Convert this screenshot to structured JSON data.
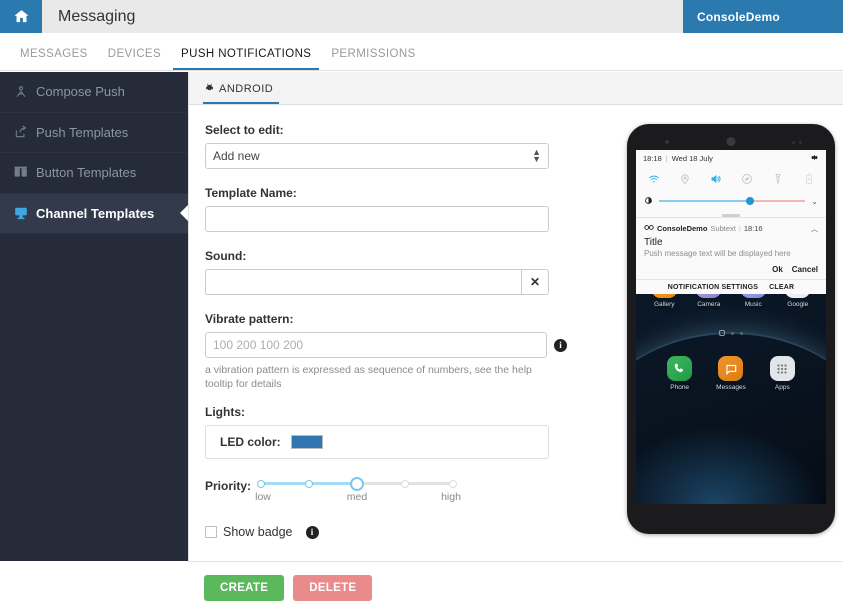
{
  "header": {
    "home_icon": "home-icon",
    "title": "Messaging",
    "console_tab": "ConsoleDemo"
  },
  "nav_tabs": [
    {
      "label": "MESSAGES",
      "active": false
    },
    {
      "label": "DEVICES",
      "active": false
    },
    {
      "label": "PUSH NOTIFICATIONS",
      "active": true
    },
    {
      "label": "PERMISSIONS",
      "active": false
    }
  ],
  "sidebar": {
    "items": [
      {
        "label": "Compose Push",
        "icon": "compose-push-icon",
        "active": false
      },
      {
        "label": "Push Templates",
        "icon": "share-arrow-icon",
        "active": false
      },
      {
        "label": "Button Templates",
        "icon": "buttons-icon",
        "active": false
      },
      {
        "label": "Channel Templates",
        "icon": "channel-monitor-icon",
        "active": true
      }
    ]
  },
  "main": {
    "platform_tab": {
      "label": "ANDROID",
      "icon": "android-icon"
    },
    "select_to_edit": {
      "label": "Select to edit:",
      "value": "Add new",
      "options": [
        "Add new"
      ]
    },
    "template_name": {
      "label": "Template Name:",
      "value": "",
      "placeholder": ""
    },
    "sound": {
      "label": "Sound:",
      "value": "",
      "placeholder": "",
      "clear_icon": "close-icon"
    },
    "vibrate": {
      "label": "Vibrate pattern:",
      "value": "",
      "placeholder": "100 200 100 200",
      "info_icon": "info-icon",
      "help": "a vibration pattern is expressed as sequence of numbers, see the help tooltip for details"
    },
    "lights": {
      "label": "Lights:",
      "led_label": "LED color:",
      "led_color": "#3276b1"
    },
    "priority": {
      "label": "Priority:",
      "ticks": [
        "low",
        "",
        "med",
        "",
        "high"
      ],
      "tick_labels": [
        {
          "text": "low",
          "pos": 0
        },
        {
          "text": "med",
          "pos": 2
        },
        {
          "text": "high",
          "pos": 4
        }
      ],
      "value_index": 2,
      "value": "med"
    },
    "show_badge": {
      "label": "Show badge",
      "checked": false,
      "info_icon": "info-icon"
    }
  },
  "phone_preview": {
    "status": {
      "time": "18:18",
      "separator": "|",
      "date": "Wed 18 July",
      "settings_icon": "gear-icon"
    },
    "quick_settings": [
      {
        "name": "wifi-icon",
        "active": true
      },
      {
        "name": "location-icon",
        "active": false
      },
      {
        "name": "sound-icon",
        "active": true
      },
      {
        "name": "shazam-icon",
        "active": false
      },
      {
        "name": "flashlight-icon",
        "active": false
      },
      {
        "name": "power-saving-icon",
        "active": false
      }
    ],
    "brightness": {
      "icon": "brightness-icon",
      "level": 62,
      "expand_icon": "chevron-down-icon"
    },
    "notification": {
      "app_icon": "app-badge-icon",
      "app_name": "ConsoleDemo",
      "subtext": "Subtext",
      "divider": "|",
      "time": "18:16",
      "collapse_icon": "chevron-up-icon",
      "title": "Title",
      "body": "Push message text will be displayed here",
      "actions": [
        "Ok",
        "Cancel"
      ]
    },
    "footer_actions": [
      "NOTIFICATION SETTINGS",
      "CLEAR"
    ],
    "home_apps_row1": [
      {
        "name": "Gallery",
        "icon": "gallery-icon"
      },
      {
        "name": "Camera",
        "icon": "camera-icon"
      },
      {
        "name": "Music",
        "icon": "music-icon"
      },
      {
        "name": "Google",
        "icon": "google-folder-icon"
      }
    ],
    "home_apps_row2": [
      {
        "name": "Phone",
        "icon": "phone-icon"
      },
      {
        "name": "Messages",
        "icon": "messages-icon"
      },
      {
        "name": "Apps",
        "icon": "apps-grid-icon"
      }
    ]
  },
  "footer": {
    "create_label": "CREATE",
    "delete_label": "DELETE",
    "create_color": "#5cb85c",
    "delete_color": "#ea8a8a"
  }
}
